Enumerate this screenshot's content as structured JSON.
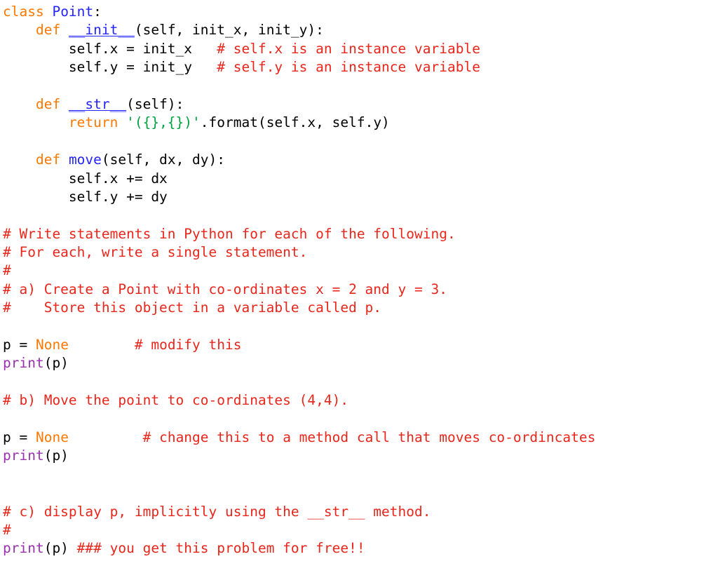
{
  "editor": {
    "language": "Python",
    "background_color": "#ffffff",
    "default_text_color": "#000000",
    "colors": {
      "keyword": "#ff7800",
      "builtin": "#9b30b0",
      "definition_name": "#2424ff",
      "class_name": "#2424ff",
      "string": "#00a33f",
      "comment": "#e8261c",
      "default": "#000000"
    }
  },
  "code": {
    "lines": [
      {
        "id": "line-1",
        "tokens": [
          {
            "text": "class ",
            "type": "keyword"
          },
          {
            "text": "Point",
            "type": "classname"
          },
          {
            "text": ":",
            "type": "default"
          }
        ]
      },
      {
        "id": "line-2",
        "tokens": [
          {
            "text": "    ",
            "type": "default"
          },
          {
            "text": "def ",
            "type": "keyword"
          },
          {
            "text": "__init__",
            "type": "defname-dunder"
          },
          {
            "text": "(self, init_x, init_y):",
            "type": "default"
          }
        ]
      },
      {
        "id": "line-3",
        "tokens": [
          {
            "text": "        self.x = init_x   ",
            "type": "default"
          },
          {
            "text": "# self.x is an instance variable",
            "type": "comment"
          }
        ]
      },
      {
        "id": "line-4",
        "tokens": [
          {
            "text": "        self.y = init_y   ",
            "type": "default"
          },
          {
            "text": "# self.y is an instance variable",
            "type": "comment"
          }
        ]
      },
      {
        "id": "line-5",
        "tokens": [
          {
            "text": "",
            "type": "default"
          }
        ]
      },
      {
        "id": "line-6",
        "tokens": [
          {
            "text": "    ",
            "type": "default"
          },
          {
            "text": "def ",
            "type": "keyword"
          },
          {
            "text": "__str__",
            "type": "defname-dunder"
          },
          {
            "text": "(self):",
            "type": "default"
          }
        ]
      },
      {
        "id": "line-7",
        "tokens": [
          {
            "text": "        ",
            "type": "default"
          },
          {
            "text": "return ",
            "type": "keyword"
          },
          {
            "text": "'({},{})'",
            "type": "string"
          },
          {
            "text": ".format(self.x, self.y)",
            "type": "default"
          }
        ]
      },
      {
        "id": "line-8",
        "tokens": [
          {
            "text": "",
            "type": "default"
          }
        ]
      },
      {
        "id": "line-9",
        "tokens": [
          {
            "text": "    ",
            "type": "default"
          },
          {
            "text": "def ",
            "type": "keyword"
          },
          {
            "text": "move",
            "type": "defname"
          },
          {
            "text": "(self, dx, dy):",
            "type": "default"
          }
        ]
      },
      {
        "id": "line-10",
        "tokens": [
          {
            "text": "        self.x += dx",
            "type": "default"
          }
        ]
      },
      {
        "id": "line-11",
        "tokens": [
          {
            "text": "        self.y += dy",
            "type": "default"
          }
        ]
      },
      {
        "id": "line-12",
        "tokens": [
          {
            "text": "",
            "type": "default"
          }
        ]
      },
      {
        "id": "line-13",
        "tokens": [
          {
            "text": "# Write statements in Python for each of the following.",
            "type": "comment"
          }
        ]
      },
      {
        "id": "line-14",
        "tokens": [
          {
            "text": "# For each, write a single statement.",
            "type": "comment"
          }
        ]
      },
      {
        "id": "line-15",
        "tokens": [
          {
            "text": "#",
            "type": "comment"
          }
        ]
      },
      {
        "id": "line-16",
        "tokens": [
          {
            "text": "# a) Create a Point with co-ordinates x = 2 and y = 3.",
            "type": "comment"
          }
        ]
      },
      {
        "id": "line-17",
        "tokens": [
          {
            "text": "#    Store this object in a variable called p.",
            "type": "comment"
          }
        ]
      },
      {
        "id": "line-18",
        "tokens": [
          {
            "text": "",
            "type": "default"
          }
        ]
      },
      {
        "id": "line-19",
        "tokens": [
          {
            "text": "p = ",
            "type": "default"
          },
          {
            "text": "None",
            "type": "keyword"
          },
          {
            "text": "        ",
            "type": "default"
          },
          {
            "text": "# modify this",
            "type": "comment"
          }
        ]
      },
      {
        "id": "line-20",
        "tokens": [
          {
            "text": "print",
            "type": "builtin"
          },
          {
            "text": "(p)",
            "type": "default"
          }
        ]
      },
      {
        "id": "line-21",
        "tokens": [
          {
            "text": "",
            "type": "default"
          }
        ]
      },
      {
        "id": "line-22",
        "tokens": [
          {
            "text": "# b) Move the point to co-ordinates (4,4).",
            "type": "comment"
          }
        ]
      },
      {
        "id": "line-23",
        "tokens": [
          {
            "text": "",
            "type": "default"
          }
        ]
      },
      {
        "id": "line-24",
        "tokens": [
          {
            "text": "p = ",
            "type": "default"
          },
          {
            "text": "None",
            "type": "keyword"
          },
          {
            "text": "         ",
            "type": "default"
          },
          {
            "text": "# change this to a method call that moves co-ordincates",
            "type": "comment"
          }
        ]
      },
      {
        "id": "line-25",
        "tokens": [
          {
            "text": "print",
            "type": "builtin"
          },
          {
            "text": "(p)",
            "type": "default"
          }
        ]
      },
      {
        "id": "line-26",
        "tokens": [
          {
            "text": "",
            "type": "default"
          }
        ]
      },
      {
        "id": "line-27",
        "tokens": [
          {
            "text": "",
            "type": "default"
          }
        ]
      },
      {
        "id": "line-28",
        "tokens": [
          {
            "text": "# c) display p, implicitly using the __str__ method.",
            "type": "comment"
          }
        ]
      },
      {
        "id": "line-29",
        "tokens": [
          {
            "text": "#",
            "type": "comment"
          }
        ]
      },
      {
        "id": "line-30",
        "tokens": [
          {
            "text": "print",
            "type": "builtin"
          },
          {
            "text": "(p) ",
            "type": "default"
          },
          {
            "text": "### you get this problem for free!!",
            "type": "comment"
          }
        ]
      }
    ]
  }
}
